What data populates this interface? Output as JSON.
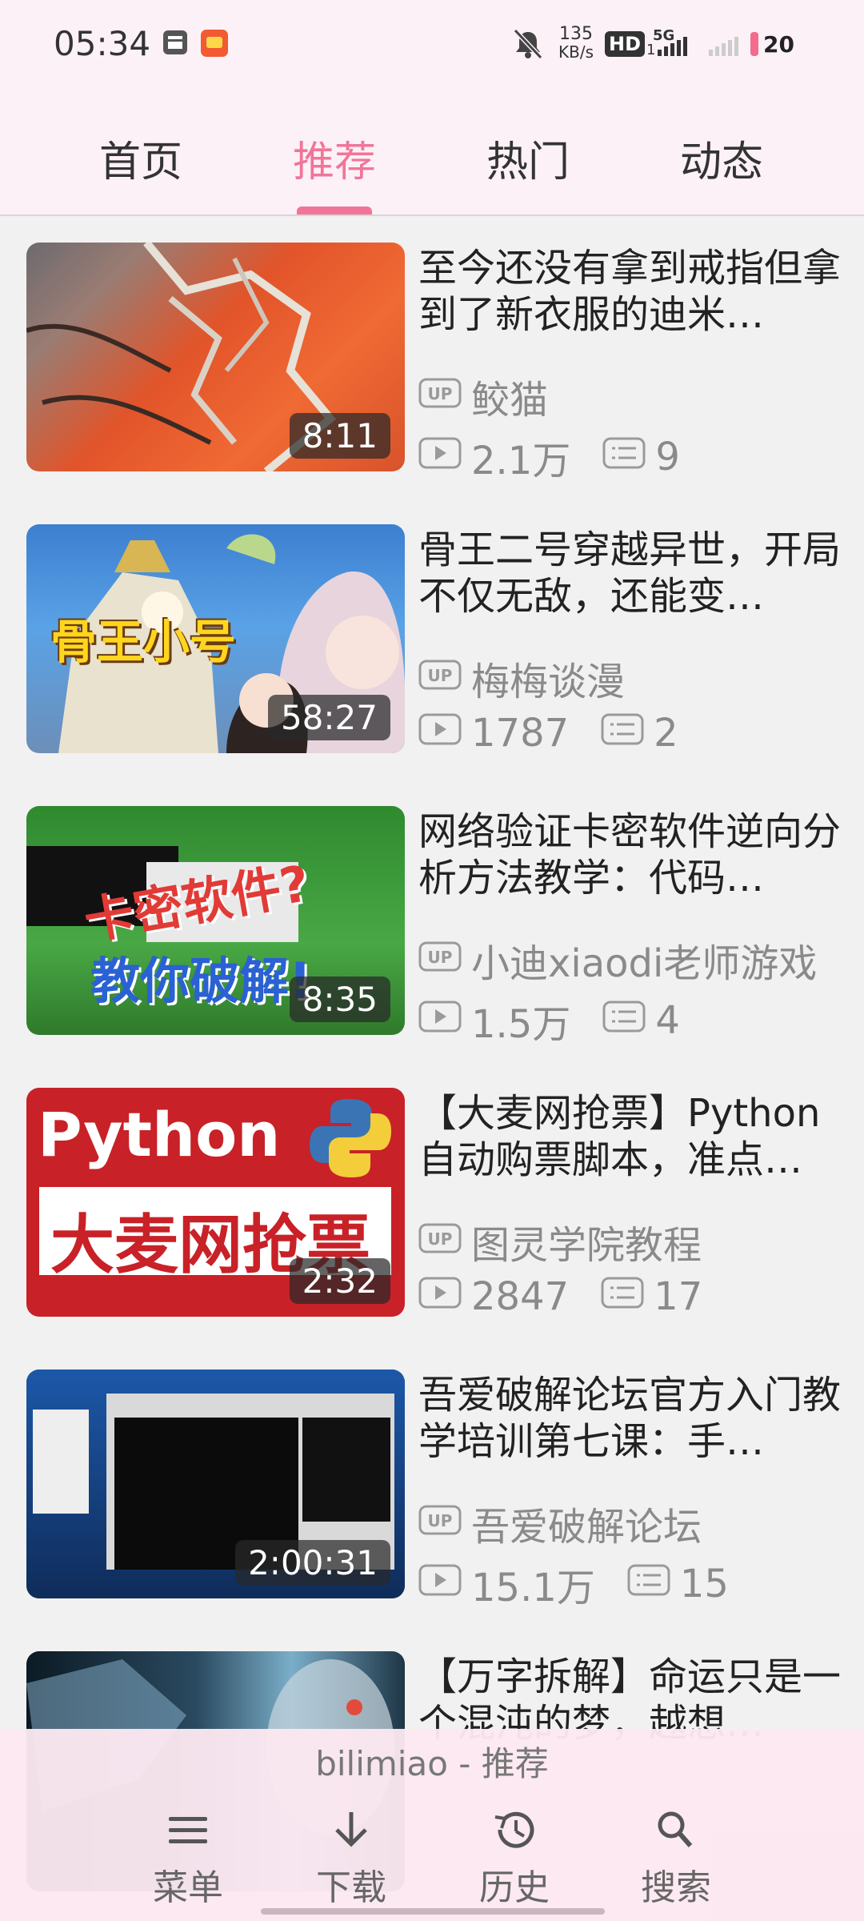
{
  "status_bar": {
    "time": "05:34",
    "net_speed": "135\nKB/s",
    "net_speed_value": "135",
    "net_speed_unit": "KB/s",
    "hd_label": "HD",
    "hd_sub": "1",
    "network_type": "5G",
    "battery": "20",
    "icons": [
      "notification-app-icon",
      "shopping-app-icon",
      "mute-bell-icon",
      "hd-volte-icon",
      "signal-5g-icon",
      "signal-weak-icon",
      "battery-icon"
    ]
  },
  "tabs": [
    {
      "label": "首页",
      "active": false
    },
    {
      "label": "推荐",
      "active": true
    },
    {
      "label": "热门",
      "active": false
    },
    {
      "label": "动态",
      "active": false
    }
  ],
  "colors": {
    "accent": "#f07599",
    "topbar_bg": "#fcf1f6",
    "list_bg": "#f1f1f1",
    "bottom_bg": "#fce8f0"
  },
  "videos": [
    {
      "title": "至今还没有拿到戒指但拿到了新衣服的迪米…",
      "uploader": "鲛猫",
      "views": "2.1万",
      "comments": "9",
      "duration": "8:11",
      "thumb_text_1": "",
      "thumb_text_2": ""
    },
    {
      "title": "骨王二号穿越异世，开局不仅无敌，还能变…",
      "uploader": "梅梅谈漫",
      "views": "1787",
      "comments": "2",
      "duration": "58:27",
      "thumb_text_1": "骨王小号",
      "thumb_text_2": ""
    },
    {
      "title": "网络验证卡密软件逆向分析方法教学：代码…",
      "uploader": "小迪xiaodi老师游戏",
      "views": "1.5万",
      "comments": "4",
      "duration": "8:35",
      "thumb_text_1": "卡密软件?",
      "thumb_text_2": "教你破解!"
    },
    {
      "title": "【大麦网抢票】Python自动购票脚本，准点…",
      "uploader": "图灵学院教程",
      "views": "2847",
      "comments": "17",
      "duration": "2:32",
      "thumb_text_1": "Python",
      "thumb_text_2": "大麦网抢票"
    },
    {
      "title": "吾爱破解论坛官方入门教学培训第七课：手…",
      "uploader": "吾爱破解论坛",
      "views": "15.1万",
      "comments": "15",
      "duration": "2:00:31",
      "thumb_text_1": "",
      "thumb_text_2": ""
    },
    {
      "title": "【万字拆解】命运只是一个混沌的梦，越想…",
      "uploader": "",
      "views": "",
      "comments": "",
      "duration": "",
      "thumb_text_1": "",
      "thumb_text_2": ""
    }
  ],
  "bottom_bar": {
    "app_title": "bilimiao - 推荐",
    "items": [
      {
        "label": "菜单",
        "icon": "menu-icon"
      },
      {
        "label": "下载",
        "icon": "download-icon"
      },
      {
        "label": "历史",
        "icon": "history-icon"
      },
      {
        "label": "搜索",
        "icon": "search-icon"
      }
    ]
  }
}
